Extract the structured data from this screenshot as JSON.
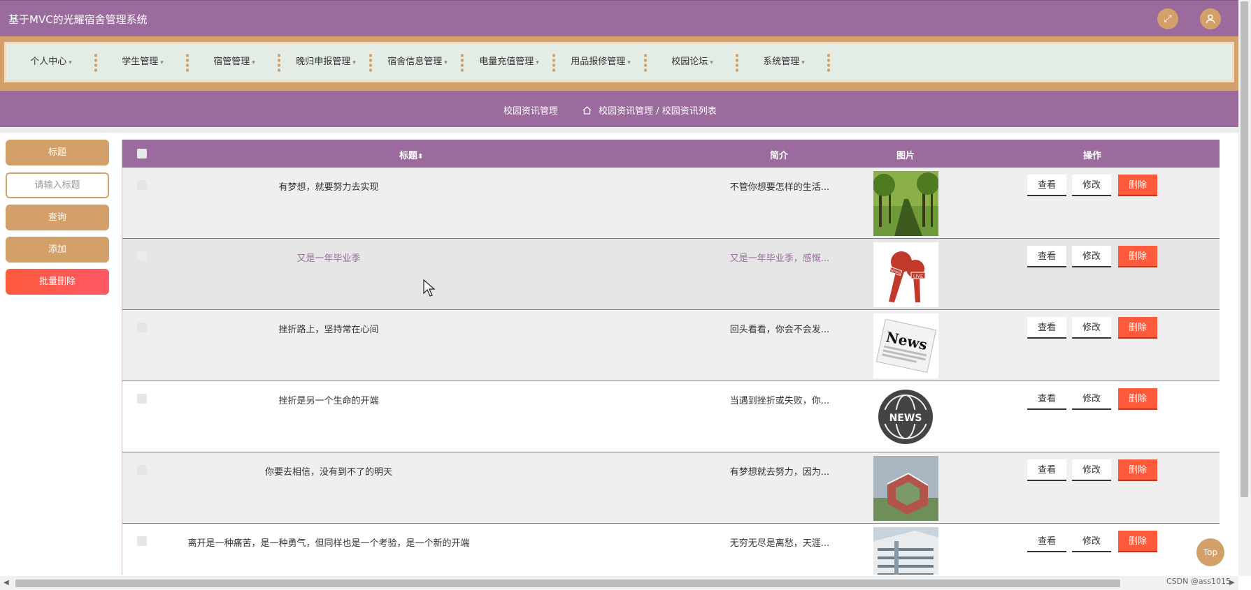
{
  "header": {
    "title": "基于MVC的光耀宿舍管理系统",
    "fullscreen_icon": "expand-icon",
    "user_icon": "user-icon"
  },
  "nav": {
    "items": [
      {
        "label": "个人中心"
      },
      {
        "label": "学生管理"
      },
      {
        "label": "宿管管理"
      },
      {
        "label": "晚归申报管理"
      },
      {
        "label": "宿舍信息管理"
      },
      {
        "label": "电量充值管理"
      },
      {
        "label": "用品报修管理"
      },
      {
        "label": "校园论坛"
      },
      {
        "label": "系统管理"
      }
    ]
  },
  "breadcrumb": {
    "section": "校园资讯管理",
    "path": "校园资讯管理 / 校园资讯列表"
  },
  "sidebar": {
    "field_label": "标题",
    "search_placeholder": "请输入标题",
    "query_label": "查询",
    "add_label": "添加",
    "batch_delete_label": "批量删除"
  },
  "table": {
    "headers": {
      "title": "标题",
      "intro": "简介",
      "image": "图片",
      "actions": "操作"
    },
    "sort_icon": "sort-icon",
    "rows": [
      {
        "title": "有梦想，就要努力去实现",
        "intro": "不管你想要怎样的生活...",
        "image": "forest-path"
      },
      {
        "title": "又是一年毕业季",
        "intro": "又是一年毕业季，感慨...",
        "image": "news-microphones",
        "highlighted": true
      },
      {
        "title": "挫折路上，坚持常在心间",
        "intro": "回头看看，你会不会发...",
        "image": "newspaper"
      },
      {
        "title": "挫折是另一个生命的开端",
        "intro": "当遇到挫折或失败，你...",
        "image": "news-globe"
      },
      {
        "title": "你要去相信，没有到不了的明天",
        "intro": "有梦想就去努力，因为...",
        "image": "campus-aerial"
      },
      {
        "title": "离开是一种痛苦，是一种勇气，但同样也是一个考验，是一个新的开端",
        "intro": "无穷无尽是离愁，天涯...",
        "image": "campus-building"
      }
    ],
    "actions": {
      "view": "查看",
      "edit": "修改",
      "delete": "删除"
    }
  },
  "news_labels": {
    "live": "LIVE",
    "news": "NEWS",
    "paper": "News"
  },
  "top_button": "Top",
  "watermark": "CSDN @ass1015"
}
